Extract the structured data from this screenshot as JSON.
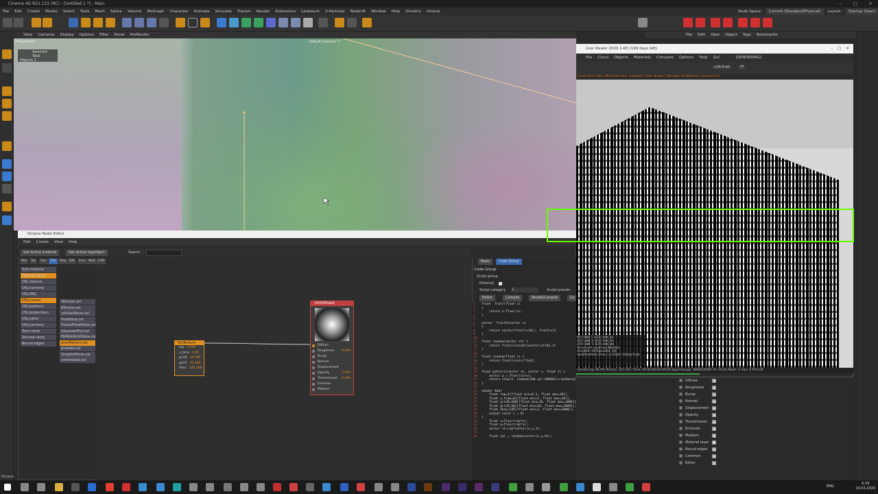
{
  "window": {
    "title": "Cinema 4D R21.115 (RC) - [Untitled 1 *] - Main"
  },
  "menubar": {
    "items": [
      "File",
      "Edit",
      "Create",
      "Modes",
      "Select",
      "Tools",
      "Mesh",
      "Spline",
      "Volume",
      "MoGraph",
      "Character",
      "Animate",
      "Simulate",
      "Tracker",
      "Render",
      "Extensions",
      "Laubwerk",
      "X-Particles",
      "Redshift",
      "Window",
      "Help",
      "Ornatrix",
      "Octane"
    ],
    "node_space_label": "Node Space:",
    "node_space_value": "Current (Standard/Physical)",
    "layout_label": "Layout:",
    "layout_value": "Startup (User)"
  },
  "viewport": {
    "menu": [
      "View",
      "Cameras",
      "Display",
      "Options",
      "Filter",
      "Panel",
      "ProRender"
    ],
    "perspective_label": "Perspective",
    "camera_label": "Default Camera °•",
    "info_header": "Selected Total",
    "info_objects": "Objects  1"
  },
  "object_manager": {
    "menu": [
      "File",
      "Edit",
      "View",
      "Object",
      "Tags",
      "Bookmarks"
    ]
  },
  "node_editor": {
    "title": "Octane Node Editor",
    "menu": [
      "Edit",
      "Create",
      "View",
      "Help"
    ],
    "btn_get_material": "Get Active material",
    "btn_get_tag": "Get Active tag/object",
    "search_label": "Search",
    "category_tabs": [
      "Mat",
      "Tex",
      "Gen",
      "OSL",
      "Map",
      "Oth",
      "Ems",
      "Med",
      "C4D"
    ],
    "node_categories": [
      "Sub material",
      "Material layer",
      "OSL texture",
      "OSL(camera)",
      "OSL(MS)",
      "OSL(noise)",
      "OSL(pattern)",
      "OSL(projection)",
      "OSL(utils)",
      "OSL(vectors)",
      "Toon ramp",
      "Volume ramp",
      "Round edges"
    ],
    "noise_items": [
      "3Dnoise.osl",
      "BSnoise.osl",
      "cellularNoise.osl",
      "flowNoise.osl",
      "FractalFlowNoise.osl",
      "GaussianBlur.osl",
      "MANdelbrotNoise.osl",
      "pixelPattern.osl",
      "pixelate.osl",
      "SimplexNoise.osl",
      "voronoisep.osl"
    ],
    "osl_node": {
      "title": "OslTexture",
      "params": [
        {
          "name": "rep",
          "value": "1.000"
        },
        {
          "name": "u_time",
          "value": "0.00"
        },
        {
          "name": "gridX",
          "value": "10.000"
        },
        {
          "name": "gridY",
          "value": "10.000"
        },
        {
          "name": "dens",
          "value": "145.000"
        }
      ]
    },
    "diffuse_node": {
      "title": "OctDiffuse1",
      "inputs": [
        {
          "name": "Diffuse",
          "value": ""
        },
        {
          "name": "Roughness",
          "value": "0.000"
        },
        {
          "name": "Bump",
          "value": ""
        },
        {
          "name": "Normal",
          "value": ""
        },
        {
          "name": "Displacement",
          "value": ""
        },
        {
          "name": "Opacity",
          "value": "1.000"
        },
        {
          "name": "Transmission",
          "value": "0.000"
        },
        {
          "name": "Emission",
          "value": ""
        },
        {
          "name": "Medium",
          "value": ""
        }
      ]
    }
  },
  "code_panel": {
    "tab_basic": "Basic",
    "tab_code_group": "Code Group",
    "header": "Code Group",
    "script_group": "Script group",
    "external_label": "External",
    "script_category_label": "Script category",
    "script_category_value": "L",
    "script_presets_label": "Script presets",
    "btn_editor": "Editor",
    "btn_compile": "Compile",
    "btn_reset_compile": "Reset&Compile",
    "btn_go": "Go",
    "code_lines": [
      "float  fract(float x)",
      "{",
      "    return x-floor(x);",
      "}",
      "",
      "vector  fractV(vector v)",
      "{",
      "    return vector(fract(v[0]), fract(v[1",
      "}",
      "",
      "float random(vector st) {",
      "    return fract(sin(dot(vector(st[0],st",
      "}",
      "",
      "float random(float x) {",
      "    return fract(sin(x)*1e4);",
      "}",
      "",
      "float pattern(vector st, vector v, float t) {",
      "    vector p = floor(st+v);",
      "    return step(t, random(100.+p*.000001)+random(p[0])*0.4 );",
      "}",
      "",
      "shader Add(",
      "    float rep=1[[float min=0.1, float max=10]],",
      "    float u_time=0[[float min=1, float max=10]],",
      "    float gridX=100[[float min=10, float max=1000]],",
      "    float gridY=50[[float min=10, float max=1000]],",
      "    float dens=145[[float min=1, float max=3000]],",
      "    output color c = 0)",
      "{",
      "    float x=floor(rep*u);",
      "    float y=floor(rep*v);",
      "    vector st=rep*vector(x,y,1);",
      "",
      "    float val = random(vector(x,y,0));"
    ]
  },
  "live_viewer": {
    "title": "Live Viewer 2020.1-R3 (199 days left)",
    "menu": [
      "File",
      "Cloud",
      "Objects",
      "Materials",
      "Compare",
      "Options",
      "Help",
      "Gui"
    ],
    "rendering_label": "[RENDERING]",
    "mode_value": "LDR-8-bit",
    "pt_value": "PT",
    "status_text": "Check:0ms./0ms. MeshGen:0ms. Update[C]:0ms Nodes:7 Movable:16 Meshes:1 Instances:0",
    "stats": [
      "RTX 2080 Ti (GTX)   9/8C    44",
      "GTX 1080 Ti (GTX)   9/8C    90",
      "GTX 1080 Ti (GTX)   9/8C    88",
      "Out-of-core used/max:0Kb/4Gb",
      "Grey8/16: 0/0         Rgb32/64: 0/0",
      "Used/free/total vram: 1.121Gb/7.036Gb/11Gb"
    ],
    "bottom_text": "Rendering: 96.9%   Ms/sec: 327.931   Time: 00:00:00/00:00:00   Spp/maxspp: 4808/16000   Tri: 0/12k   Mesh: 1   Hair: 0   RTX:off"
  },
  "material_props": {
    "items": [
      {
        "label": "Diffuse",
        "checked": true
      },
      {
        "label": "Roughness",
        "checked": true
      },
      {
        "label": "Bump",
        "checked": true
      },
      {
        "label": "Normal",
        "checked": true
      },
      {
        "label": "Displacement",
        "checked": true
      },
      {
        "label": "Opacity",
        "checked": true
      },
      {
        "label": "Transmission",
        "checked": true
      },
      {
        "label": "Emission",
        "checked": true
      },
      {
        "label": "Medium",
        "checked": true
      },
      {
        "label": "Material layer",
        "checked": false
      },
      {
        "label": "Round edges",
        "checked": true
      },
      {
        "label": "Common",
        "checked": true
      },
      {
        "label": "Editor",
        "checked": true
      }
    ]
  },
  "taskbar": {
    "lang": "ENG",
    "time": "6:39",
    "date": "14.03.2020"
  },
  "status_line": "Octane",
  "colors": {
    "accent_orange": "#e09020",
    "diffuse_red": "#c04040",
    "highlight_green": "#66ff00"
  }
}
